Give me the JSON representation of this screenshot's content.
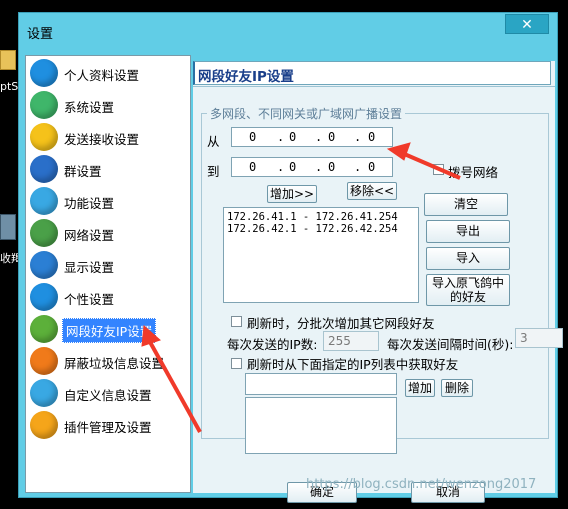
{
  "desktop": {
    "label_top": "ptS",
    "label_bottom": "收羯"
  },
  "window": {
    "title": "设置",
    "close": "✕"
  },
  "sidebar": {
    "items": [
      {
        "label": "个人资料设置",
        "color": "#1f8fe0"
      },
      {
        "label": "系统设置",
        "color": "#3fb66a"
      },
      {
        "label": "发送接收设置",
        "color": "#f5c21a"
      },
      {
        "label": "群设置",
        "color": "#2a6fc9"
      },
      {
        "label": "功能设置",
        "color": "#39a8e3"
      },
      {
        "label": "网络设置",
        "color": "#4aa048"
      },
      {
        "label": "显示设置",
        "color": "#2b7fd4"
      },
      {
        "label": "个性设置",
        "color": "#1f8fe0"
      },
      {
        "label": "网段好友IP设置",
        "color": "#5cb03a"
      },
      {
        "label": "屏蔽垃圾信息设置",
        "color": "#f07a1a"
      },
      {
        "label": "自定义信息设置",
        "color": "#39a8e3"
      },
      {
        "label": "插件管理及设置",
        "color": "#f5a51a"
      }
    ]
  },
  "panel": {
    "title": "网段好友IP设置",
    "group_caption": "多网段、不同网关或广域网广播设置",
    "from_label": "从",
    "to_label": "到",
    "from_ip": [
      "0",
      "0",
      "0",
      "0"
    ],
    "to_ip": [
      "0",
      "0",
      "0",
      "0"
    ],
    "dialup_label": "拨号网络",
    "add_button": "增加>>",
    "remove_button": "移除<<",
    "clear_button": "清空",
    "export_button": "导出",
    "import_button": "导入",
    "import_feige_button_line1": "导入原飞鸽中",
    "import_feige_button_line2": "的好友",
    "ranges": [
      "172.26.41.1 - 172.26.41.254",
      "172.26.42.1 - 172.26.42.254"
    ],
    "refresh_batch_label": "刷新时，分批次增加其它网段好友",
    "per_send_label": "每次发送的IP数:",
    "per_send_value": "255",
    "interval_label": "每次发送间隔时间(秒):",
    "interval_value": "3",
    "refresh_list_label": "刷新时从下面指定的IP列表中获取好友",
    "list_add_button": "增加",
    "list_delete_button": "删除"
  },
  "footer": {
    "ok_button": "确定",
    "cancel_button": "取消"
  },
  "watermark": "https://blog.csdn.net/wenzong2017"
}
